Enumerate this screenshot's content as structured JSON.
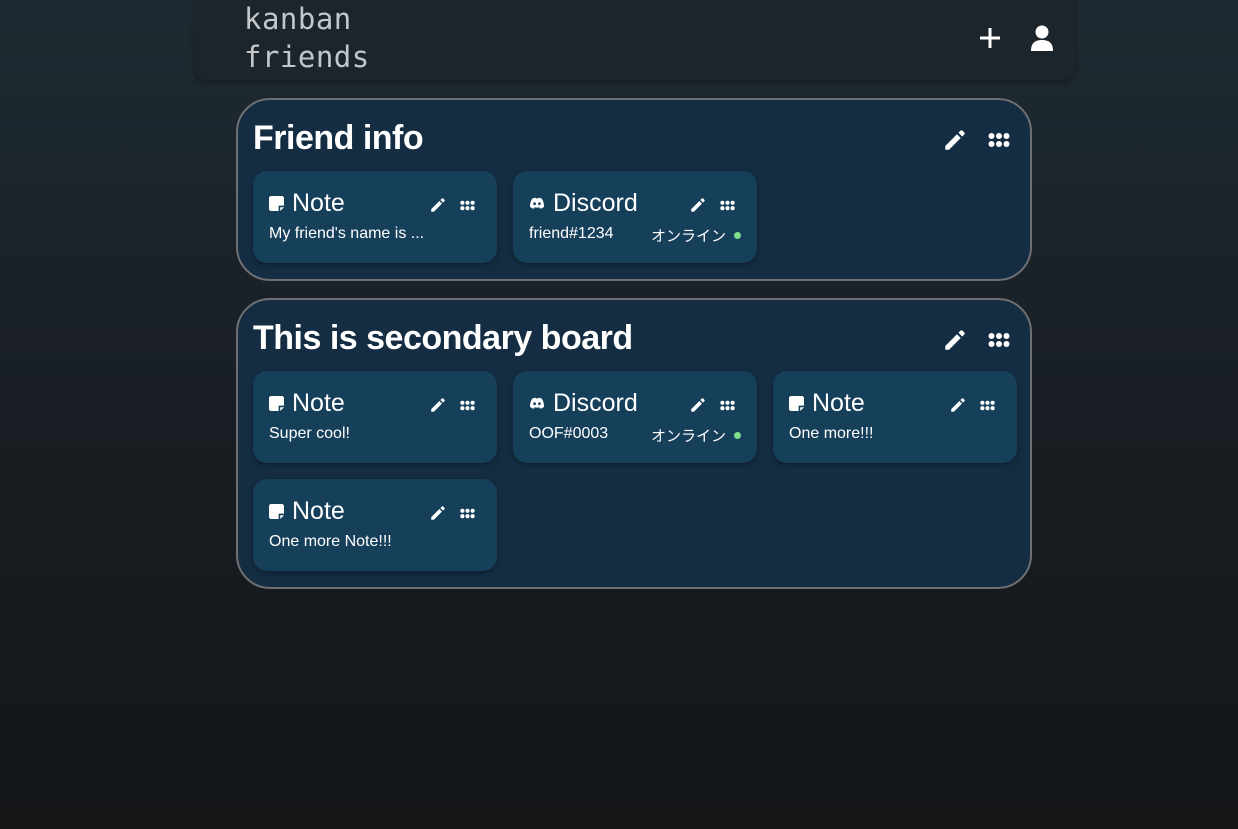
{
  "app": {
    "logo_line1": "kanban",
    "logo_line2": "friends",
    "add_icon": "plus-icon",
    "user_icon": "user-icon"
  },
  "colors": {
    "background": "#181d22",
    "header": "#1c252c",
    "board": "#142d42",
    "board_border": "#6e6f72",
    "card": "#163f5a",
    "online": "#7ee08a"
  },
  "boards": [
    {
      "title": "Friend info",
      "cards": [
        {
          "type": "note",
          "icon": "sticky-note-icon",
          "title": "Note",
          "body": "My friend's name is ..."
        },
        {
          "type": "discord",
          "icon": "discord-icon",
          "title": "Discord",
          "body": "friend#1234",
          "status": "オンライン"
        }
      ]
    },
    {
      "title": "This is secondary board",
      "cards": [
        {
          "type": "note",
          "icon": "sticky-note-icon",
          "title": "Note",
          "body": "Super cool!"
        },
        {
          "type": "discord",
          "icon": "discord-icon",
          "title": "Discord",
          "body": "OOF#0003",
          "status": "オンライン"
        },
        {
          "type": "note",
          "icon": "sticky-note-icon",
          "title": "Note",
          "body": "One more!!!"
        },
        {
          "type": "note",
          "icon": "sticky-note-icon",
          "title": "Note",
          "body": "One more Note!!!"
        }
      ]
    }
  ]
}
